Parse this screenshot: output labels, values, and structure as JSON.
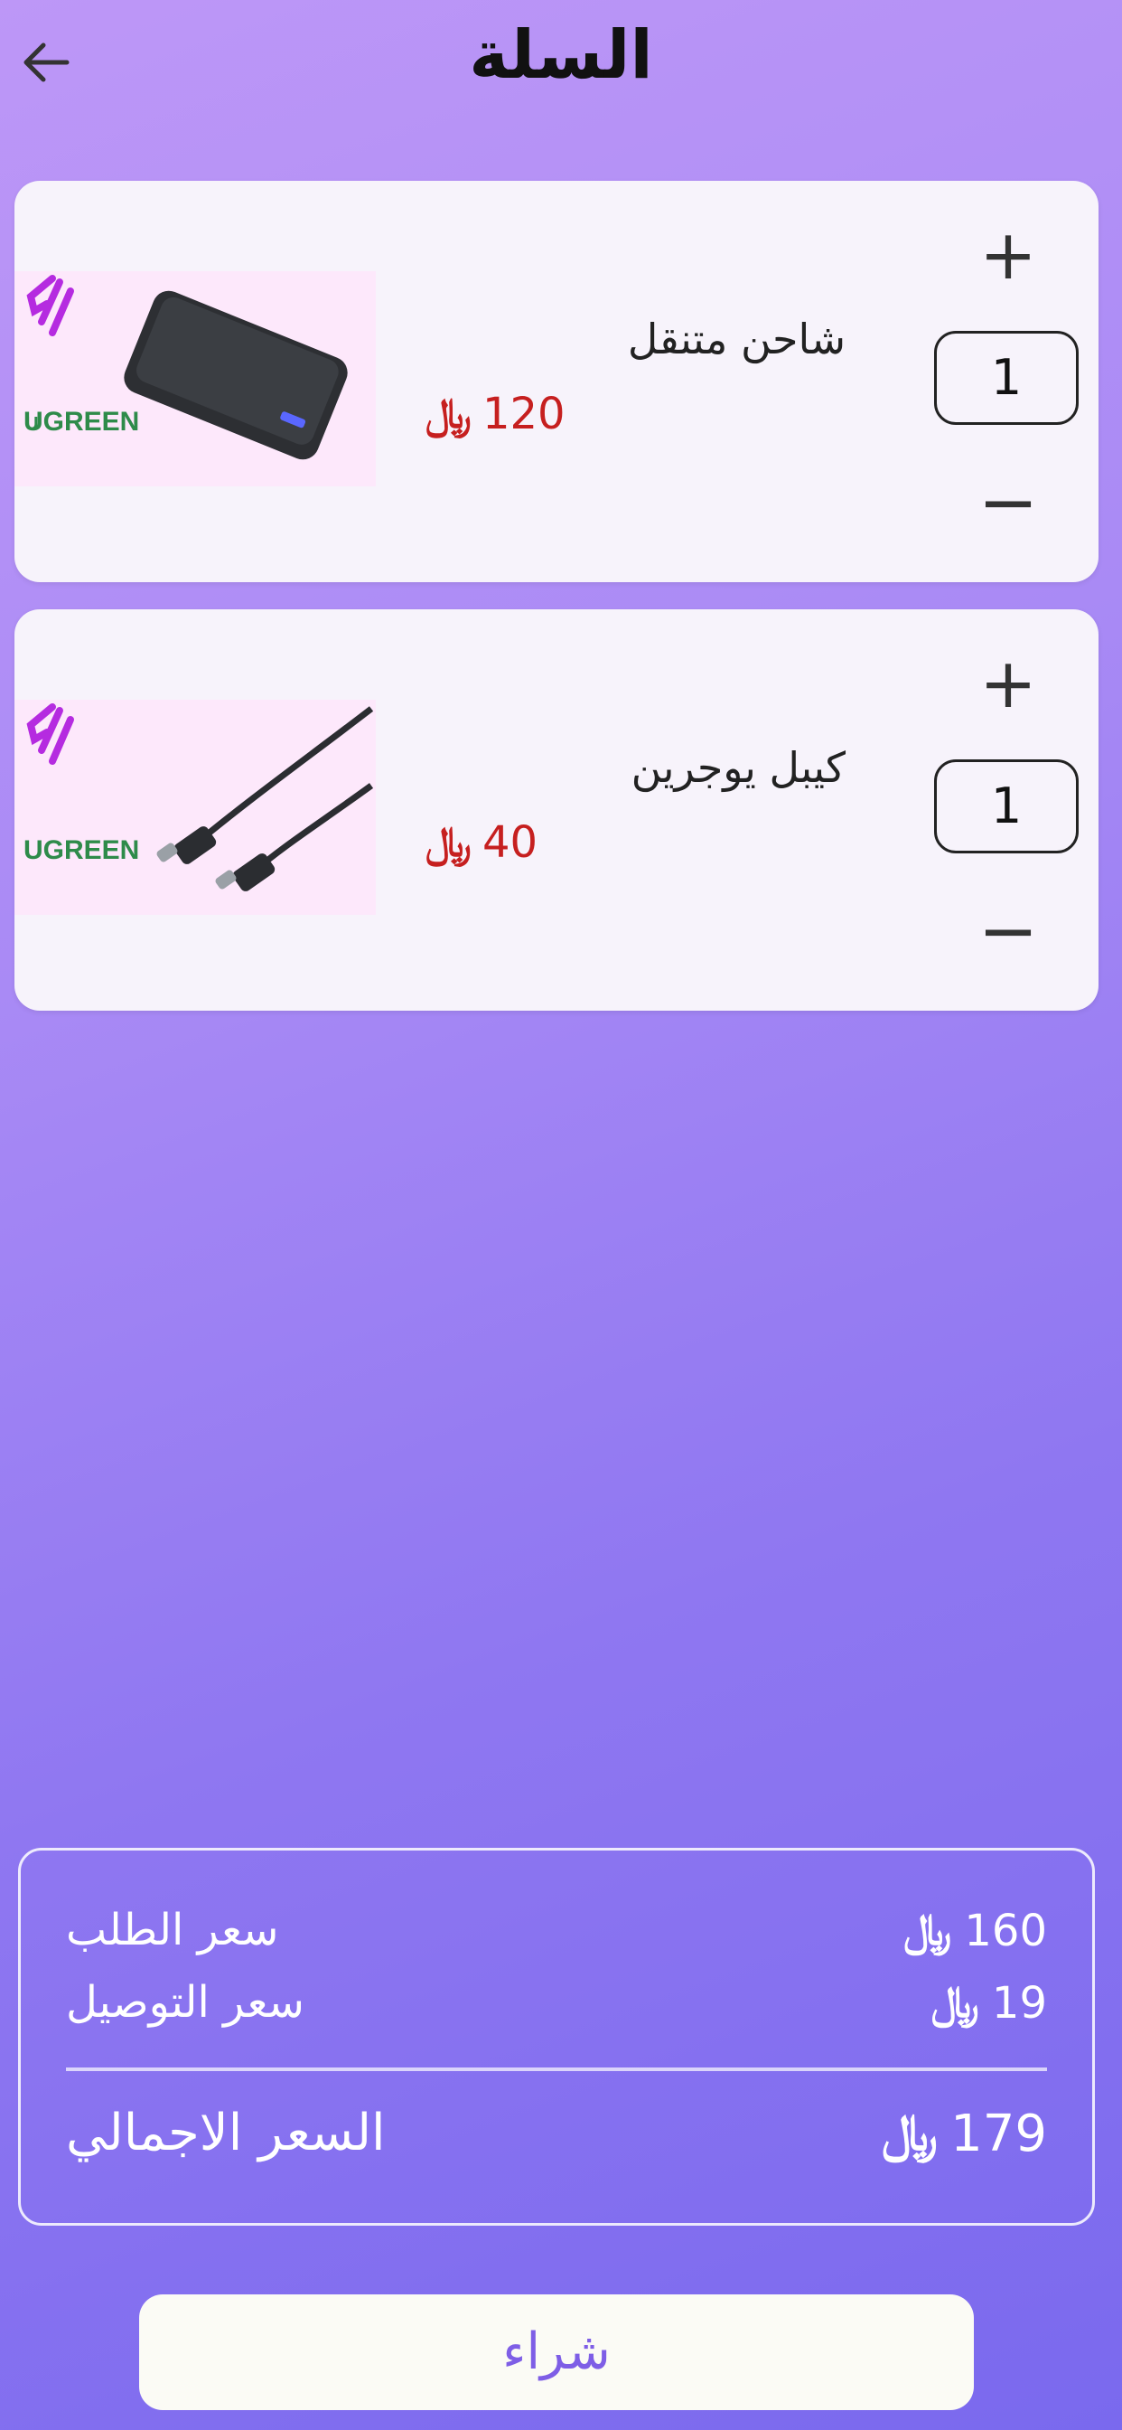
{
  "header": {
    "title": "السلة",
    "back_icon": "arrow-back-icon"
  },
  "currency_symbol": "﷼",
  "cart": {
    "items": [
      {
        "name": "شاحن متنقل",
        "price": "120",
        "quantity": "1",
        "brand": "UGREEN",
        "image": "power-bank"
      },
      {
        "name": "كيبل يوجرين",
        "price": "40",
        "quantity": "1",
        "brand": "UGREEN",
        "image": "usb-c-cable"
      }
    ]
  },
  "summary": {
    "order_price_label": "سعر الطلب",
    "order_price_value": "160",
    "delivery_price_label": "سعر التوصيل",
    "delivery_price_value": "19",
    "total_label": "السعر الاجمالي",
    "total_value": "179"
  },
  "buy_button": {
    "label": "شراء"
  },
  "colors": {
    "price_red": "#c61f1f",
    "button_text": "#7e5ee6",
    "brand_green": "#2e8b4a",
    "brand_purple": "#b52be0"
  }
}
